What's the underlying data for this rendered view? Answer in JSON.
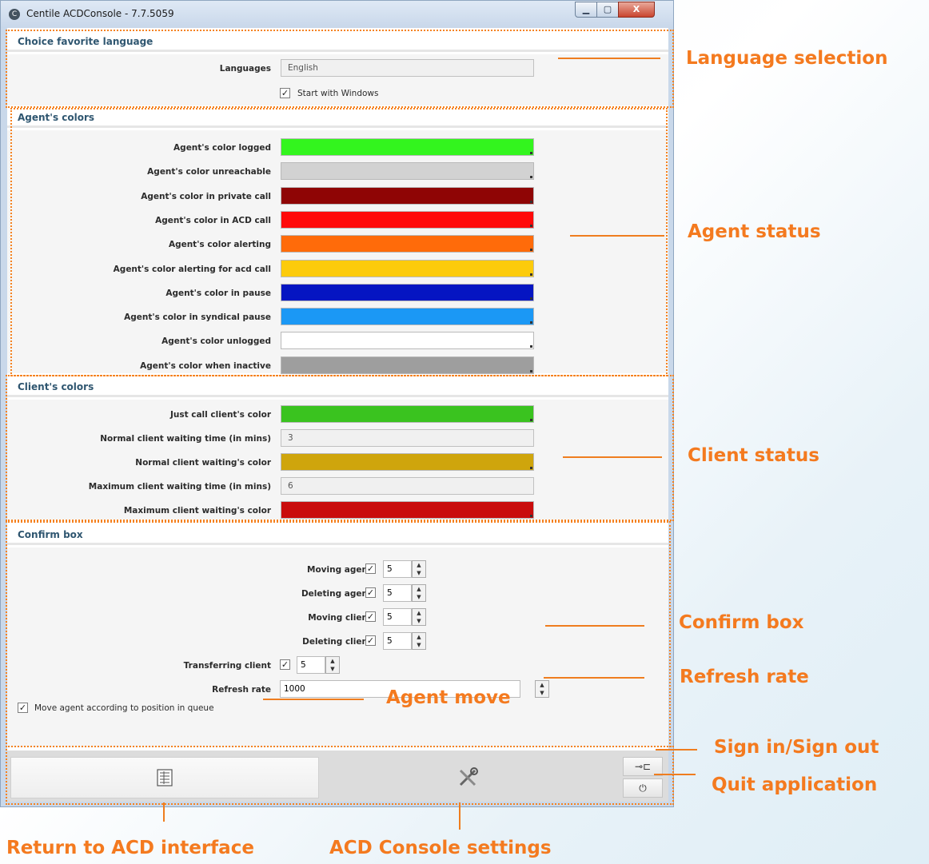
{
  "window": {
    "title": "Centile ACDConsole - 7.7.5059",
    "logo_glyph": "C",
    "min_glyph": "▁",
    "max_glyph": "▢",
    "close_glyph": "X"
  },
  "language_section": {
    "heading": "Choice favorite language",
    "languages_label": "Languages",
    "languages_value": "English",
    "start_with_windows_label": "Start with Windows",
    "start_with_windows_checked": true
  },
  "agent_colors": {
    "heading": "Agent's colors",
    "items": [
      {
        "label": "Agent's color logged",
        "color": "#33f51e"
      },
      {
        "label": "Agent's color unreachable",
        "color": "#d2d2d2"
      },
      {
        "label": "Agent's color in private call",
        "color": "#8f0505"
      },
      {
        "label": "Agent's color in ACD call",
        "color": "#ff0a0a"
      },
      {
        "label": "Agent's color alerting",
        "color": "#ff6b0a"
      },
      {
        "label": "Agent's color alerting for acd call",
        "color": "#fccb0c"
      },
      {
        "label": "Agent's color in pause",
        "color": "#0515c2"
      },
      {
        "label": "Agent's color in syndical pause",
        "color": "#1b98f5"
      },
      {
        "label": "Agent's color unlogged",
        "color": "#ffffff"
      },
      {
        "label": "Agent's color when inactive",
        "color": "#9e9e9e"
      }
    ]
  },
  "client_colors": {
    "heading": "Client's colors",
    "just_call_label": "Just call client's color",
    "just_call_color": "#3ac31f",
    "normal_time_label": "Normal client waiting time (in mins)",
    "normal_time_value": "3",
    "normal_color_label": "Normal client waiting's color",
    "normal_color": "#cfa50c",
    "max_time_label": "Maximum client waiting time (in mins)",
    "max_time_value": "6",
    "max_color_label": "Maximum client waiting's color",
    "max_color": "#c90c0c"
  },
  "confirm_box": {
    "heading": "Confirm box",
    "items": [
      {
        "label": "Moving agent",
        "checked": true,
        "value": "5"
      },
      {
        "label": "Deleting agent",
        "checked": true,
        "value": "5"
      },
      {
        "label": "Moving client",
        "checked": true,
        "value": "5"
      },
      {
        "label": "Deleting client",
        "checked": true,
        "value": "5"
      }
    ],
    "transferring_label": "Transferring client",
    "transferring_value": "5",
    "refresh_label": "Refresh rate",
    "refresh_value": "1000",
    "move_agent_label": "Move agent according to position in queue",
    "check_glyph": "✓",
    "up_glyph": "▲",
    "down_glyph": "▼"
  },
  "footer": {
    "acd_interface_icon": "list-icon",
    "settings_icon": "tools-icon",
    "sign_icon_glyph": "⊸⊏",
    "quit_icon_glyph": "⏻"
  },
  "annotations": {
    "language_selection": "Language selection",
    "agent_status": "Agent status",
    "client_status": "Client status",
    "confirm_box": "Confirm box",
    "refresh_rate": "Refresh rate",
    "agent_move": "Agent move",
    "sign_in_out": "Sign in/Sign out",
    "quit_application": "Quit application",
    "return_acd": "Return to ACD interface",
    "acd_settings": "ACD Console settings",
    "accent_color": "#f47a1f"
  }
}
